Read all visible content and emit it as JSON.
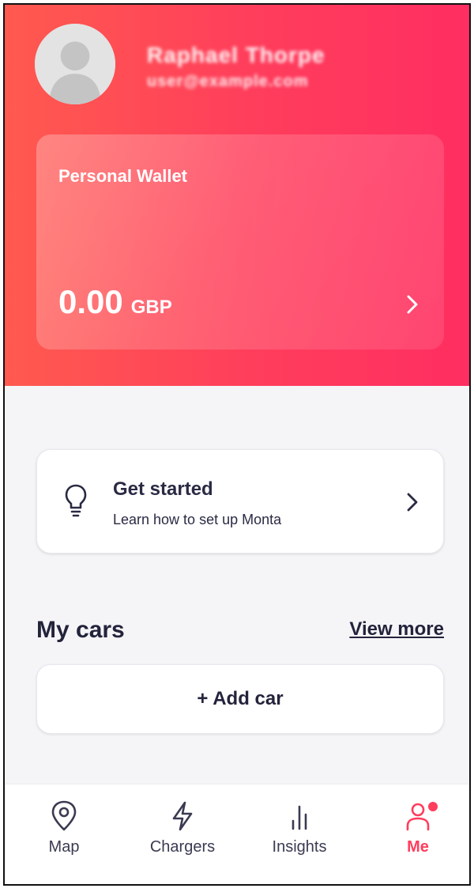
{
  "profile": {
    "name": "Raphael Thorpe",
    "email": "user@example.com"
  },
  "wallet": {
    "title": "Personal Wallet",
    "amount": "0.00",
    "currency": "GBP"
  },
  "get_started": {
    "title": "Get started",
    "subtitle": "Learn how to set up Monta"
  },
  "cars": {
    "section_title": "My cars",
    "view_more": "View more",
    "add_car": "+ Add car"
  },
  "tabs": [
    {
      "label": "Map",
      "icon": "map-pin-icon"
    },
    {
      "label": "Chargers",
      "icon": "lightning-icon"
    },
    {
      "label": "Insights",
      "icon": "bar-chart-icon"
    },
    {
      "label": "Me",
      "icon": "person-icon",
      "active": true
    }
  ],
  "colors": {
    "brand_gradient_start": "#ff5a4f",
    "brand_gradient_end": "#ff2e61",
    "accent": "#ff3d5c",
    "text_dark": "#23233b"
  }
}
